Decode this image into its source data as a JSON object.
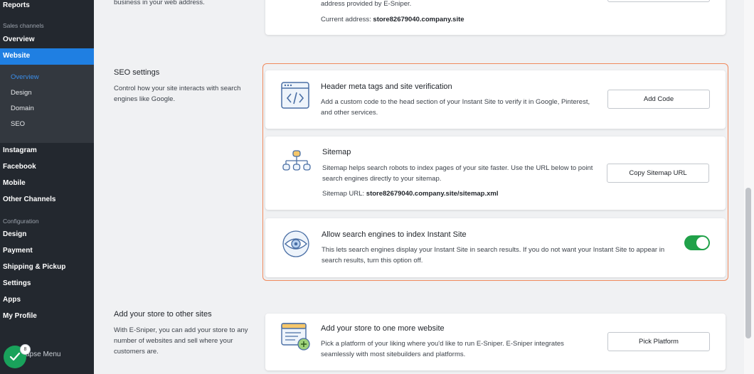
{
  "sidebar": {
    "reports": "Reports",
    "sales_channels_header": "Sales channels",
    "overview": "Overview",
    "website": "Website",
    "website_sub": [
      "Overview",
      "Design",
      "Domain",
      "SEO"
    ],
    "instagram": "Instagram",
    "facebook": "Facebook",
    "mobile": "Mobile",
    "other_channels": "Other Channels",
    "configuration_header": "Configuration",
    "design": "Design",
    "payment": "Payment",
    "shipping": "Shipping & Pickup",
    "settings": "Settings",
    "apps": "Apps",
    "my_profile": "My Profile",
    "collapse_menu": "apse Menu",
    "badge_count": "8"
  },
  "top": {
    "left_text": "business in your web address.",
    "card_line": "address provided by E-Sniper.",
    "current_address_label": "Current address:",
    "current_address_value": "store82679040.company.site"
  },
  "seo": {
    "title": "SEO settings",
    "desc": "Control how your site interacts with search engines like Google.",
    "header_meta": {
      "title": "Header meta tags and site verification",
      "desc": "Add a custom code to the head section of your Instant Site to verify it in Google, Pinterest, and other services.",
      "button": "Add Code"
    },
    "sitemap": {
      "title": "Sitemap",
      "desc": "Sitemap helps search robots to index pages of your site faster. Use the URL below to point search engines directly to your sitemap.",
      "url_label": "Sitemap URL:",
      "url_value": "store82679040.company.site/sitemap.xml",
      "button": "Copy Sitemap URL"
    },
    "indexing": {
      "title": "Allow search engines to index Instant Site",
      "desc": "This lets search engines display your Instant Site in search results. If you do not want your Instant Site to appear in search results, turn this option off.",
      "enabled": true
    }
  },
  "other_sites": {
    "title": "Add your store to other sites",
    "desc": "With E-Sniper, you can add your store to any number of websites and sell where your customers are.",
    "card_title": "Add your store to one more website",
    "card_desc": "Pick a platform of your liking where you'd like to run E-Sniper. E-Sniper integrates seamlessly with most sitebuilders and platforms.",
    "button": "Pick Platform"
  },
  "colors": {
    "sidebar_bg": "#23282f",
    "accent": "#1f7fe2",
    "toggle_on": "#20a149",
    "highlight": "#f08a5d"
  }
}
